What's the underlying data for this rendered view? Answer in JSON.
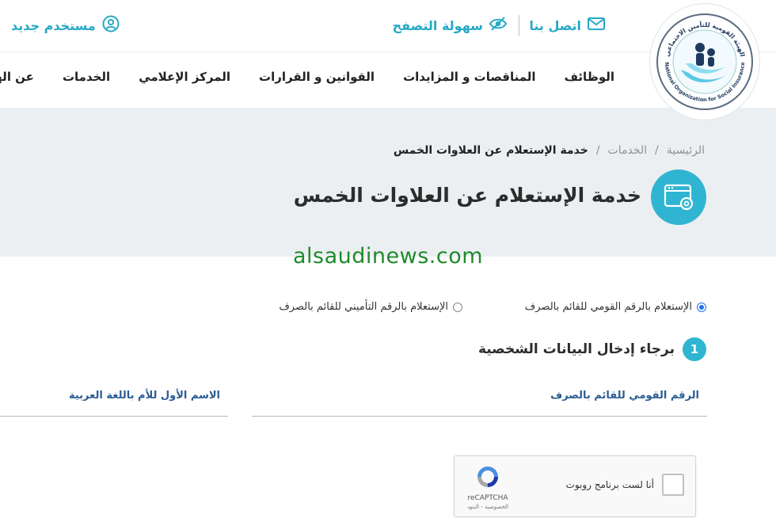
{
  "topbar": {
    "contact_label": "اتصل بنا",
    "accessibility_label": "سهولة التصفح",
    "new_user_label": "مستخدم جديد"
  },
  "nav": {
    "items": [
      {
        "label": "عن الهيئة"
      },
      {
        "label": "الخدمات"
      },
      {
        "label": "المركز الإعلامي"
      },
      {
        "label": "القوانين و القرارات"
      },
      {
        "label": "المناقصات و المزايدات"
      },
      {
        "label": "الوظائف"
      }
    ]
  },
  "logo": {
    "arabic_text": "الهيئة القومية للتأمين الاجتماعي",
    "english_text": "National Organization for Social Insurance"
  },
  "breadcrumb": {
    "home": "الرئيسية",
    "services": "الخدمات",
    "current": "خدمة الإستعلام عن العلاوات الخمس",
    "separator": "/"
  },
  "page": {
    "title": "خدمة الإستعلام عن العلاوات الخمس",
    "watermark": "alsaudinews.com"
  },
  "form": {
    "radio_options": [
      {
        "label": "الإستعلام بالرقم القومي للقائم بالصرف",
        "checked": true
      },
      {
        "label": "الإستعلام بالرقم التأميني للقائم بالصرف",
        "checked": false
      }
    ],
    "step_number": "1",
    "step_title": "برجاء إدخال البيانات الشخصية",
    "fields": {
      "national_id_label": "الرقم القومي للقائم بالصرف",
      "mother_name_label": "الاسم الأول للأم باللغة العربية"
    }
  },
  "captcha": {
    "label": "أنا لست برنامج روبوت",
    "brand": "reCAPTCHA",
    "links": "الخصوصية - البنود"
  },
  "colors": {
    "accent": "#2fb5d2",
    "link": "#27a9c6",
    "field_label": "#2a5c92",
    "watermark": "#1f8a2b",
    "hero_bg": "#eceff1"
  }
}
